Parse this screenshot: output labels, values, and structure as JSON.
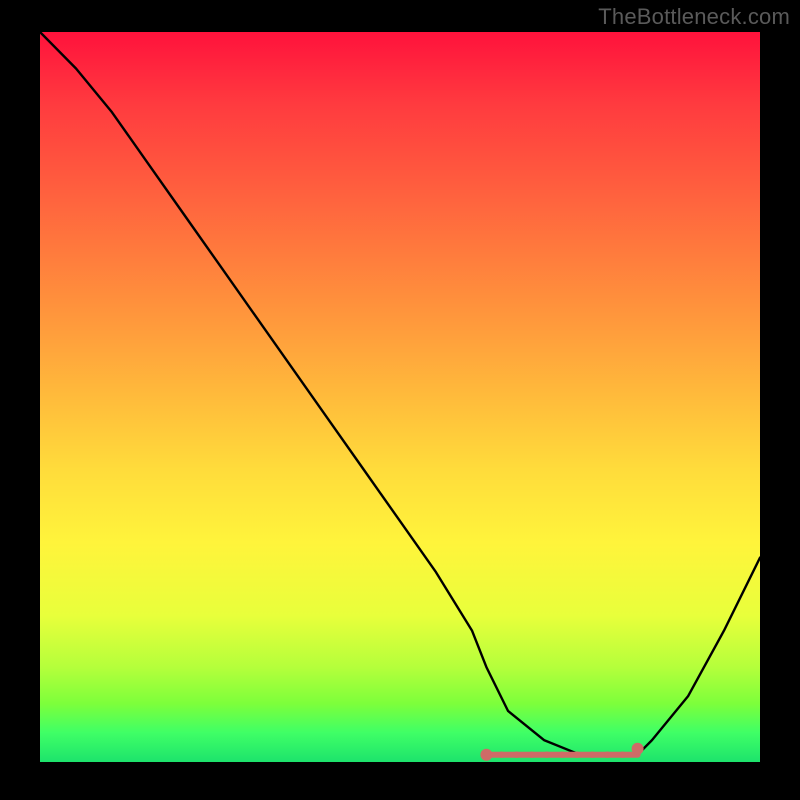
{
  "watermark": "TheBottleneck.com",
  "chart_data": {
    "type": "line",
    "title": "",
    "xlabel": "",
    "ylabel": "",
    "xlim": [
      0,
      100
    ],
    "ylim": [
      0,
      100
    ],
    "x_axis_visible": false,
    "y_axis_visible": false,
    "grid": false,
    "legend": false,
    "background": "rainbow-vertical-gradient",
    "series": [
      {
        "name": "bottleneck-curve",
        "color": "#000000",
        "x": [
          0,
          5,
          10,
          15,
          20,
          25,
          30,
          35,
          40,
          45,
          50,
          55,
          60,
          62,
          65,
          70,
          75,
          80,
          83,
          85,
          90,
          95,
          100
        ],
        "values": [
          100,
          95,
          89,
          82,
          75,
          68,
          61,
          54,
          47,
          40,
          33,
          26,
          18,
          13,
          7,
          3,
          1,
          1,
          1,
          3,
          9,
          18,
          28
        ]
      }
    ],
    "annotations": [
      {
        "name": "minimum-marker",
        "type": "scatter-band",
        "color": "#cf6b67",
        "x_range": [
          62,
          83
        ],
        "y": 1
      }
    ]
  },
  "colors": {
    "frame": "#000000",
    "watermark": "#5a5a5a",
    "curve": "#000000",
    "marker": "#cf6b67"
  }
}
